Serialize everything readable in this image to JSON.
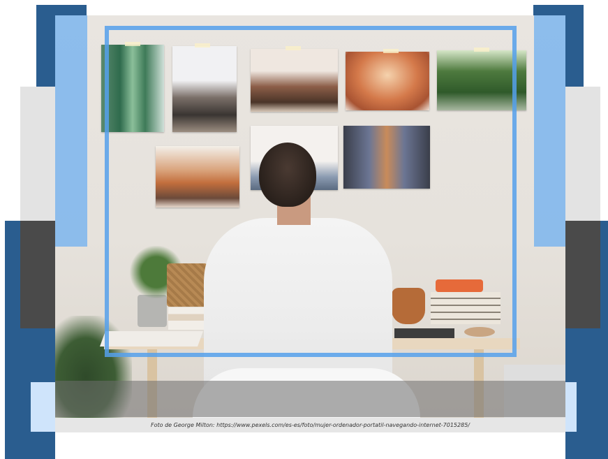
{
  "caption": "Foto de George Milton: https://www.pexels.com/es-es/foto/mujer-ordenador-portatil-navegando-internet-7015285/",
  "colors": {
    "navy": "#2a5d8f",
    "light_blue": "#6eaff0",
    "grey": "#e3e3e3",
    "dark_grey": "#4a4a4a"
  }
}
